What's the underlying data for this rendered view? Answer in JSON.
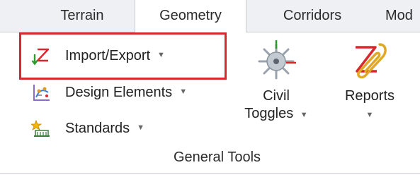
{
  "tabs": [
    {
      "label": "Terrain",
      "active": false
    },
    {
      "label": "Geometry",
      "active": true
    },
    {
      "label": "Corridors",
      "active": false
    },
    {
      "label": "Mod",
      "active": false
    }
  ],
  "ribbon": {
    "small_buttons": [
      {
        "label": "Import/Export",
        "icon": "import-export-icon",
        "has_dropdown": true,
        "highlighted": true
      },
      {
        "label": "Design Elements",
        "icon": "design-elements-icon",
        "has_dropdown": true
      },
      {
        "label": "Standards",
        "icon": "standards-icon",
        "has_dropdown": true
      }
    ],
    "large_buttons": [
      {
        "label_line1": "Civil",
        "label_line2": "Toggles",
        "icon": "civil-toggles-icon",
        "has_dropdown": true
      },
      {
        "label_line1": "Reports",
        "label_line2": "",
        "icon": "reports-icon",
        "has_dropdown": true
      }
    ],
    "group_label": "General Tools",
    "highlight_color": "#d9272e"
  }
}
